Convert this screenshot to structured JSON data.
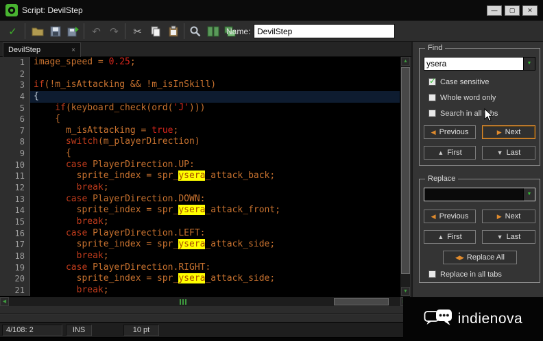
{
  "colors": {
    "accent_orange": "#e08b2d",
    "accent_green": "#3fae29",
    "match_highlight": "#ffff00",
    "editor_background": "#000000",
    "current_line_background": "#0e1c30"
  },
  "window": {
    "title": "Script: DevilStep",
    "minimize_glyph": "—",
    "maximize_glyph": "▢",
    "close_glyph": "✕"
  },
  "toolbar": {
    "accept_glyph": "✓",
    "undo_glyph": "↶",
    "redo_glyph": "↷",
    "cut_glyph": "✂",
    "name_label": "Name:",
    "name_value": "DevilStep"
  },
  "tab": {
    "label": "DevilStep",
    "close_glyph": "×"
  },
  "editor": {
    "current_line": 4,
    "lines": [
      {
        "n": 1,
        "t": [
          [
            "image_speed = ",
            "v"
          ],
          [
            "0.25",
            "l"
          ],
          [
            ";",
            "v"
          ]
        ]
      },
      {
        "n": 2,
        "t": []
      },
      {
        "n": 3,
        "t": [
          [
            "if",
            "k"
          ],
          [
            "(!m_isAttacking && !m_isInSkill)",
            "v"
          ]
        ]
      },
      {
        "n": 4,
        "t": [
          [
            "{",
            "c"
          ]
        ]
      },
      {
        "n": 5,
        "t": [
          [
            "    ",
            "v"
          ],
          [
            "if",
            "k"
          ],
          [
            "(keyboard_check(ord(",
            "v"
          ],
          [
            "'J'",
            "l"
          ],
          [
            ")))",
            "v"
          ]
        ]
      },
      {
        "n": 6,
        "t": [
          [
            "    {",
            "v"
          ]
        ]
      },
      {
        "n": 7,
        "t": [
          [
            "      m_isAttacking = ",
            "v"
          ],
          [
            "true",
            "l"
          ],
          [
            ";",
            "v"
          ]
        ]
      },
      {
        "n": 8,
        "t": [
          [
            "      ",
            "v"
          ],
          [
            "switch",
            "k"
          ],
          [
            "(m_playerDirection)",
            "v"
          ]
        ]
      },
      {
        "n": 9,
        "t": [
          [
            "      {",
            "v"
          ]
        ]
      },
      {
        "n": 10,
        "t": [
          [
            "      ",
            "v"
          ],
          [
            "case",
            "k"
          ],
          [
            " PlayerDirection.UP:",
            "v"
          ]
        ]
      },
      {
        "n": 11,
        "t": [
          [
            "        sprite_index = spr_",
            "v"
          ],
          [
            "ysera",
            "m"
          ],
          [
            "_attack_back;",
            "v"
          ]
        ]
      },
      {
        "n": 12,
        "t": [
          [
            "        ",
            "v"
          ],
          [
            "break",
            "k"
          ],
          [
            ";",
            "v"
          ]
        ]
      },
      {
        "n": 13,
        "t": [
          [
            "      ",
            "v"
          ],
          [
            "case",
            "k"
          ],
          [
            " PlayerDirection.DOWN:",
            "v"
          ]
        ]
      },
      {
        "n": 14,
        "t": [
          [
            "        sprite_index = spr_",
            "v"
          ],
          [
            "ysera",
            "m"
          ],
          [
            "_attack_front;",
            "v"
          ]
        ]
      },
      {
        "n": 15,
        "t": [
          [
            "        ",
            "v"
          ],
          [
            "break",
            "k"
          ],
          [
            ";",
            "v"
          ]
        ]
      },
      {
        "n": 16,
        "t": [
          [
            "      ",
            "v"
          ],
          [
            "case",
            "k"
          ],
          [
            " PlayerDirection.LEFT:",
            "v"
          ]
        ]
      },
      {
        "n": 17,
        "t": [
          [
            "        sprite_index = spr_",
            "v"
          ],
          [
            "ysera",
            "m"
          ],
          [
            "_attack_side;",
            "v"
          ]
        ]
      },
      {
        "n": 18,
        "t": [
          [
            "        ",
            "v"
          ],
          [
            "break",
            "k"
          ],
          [
            ";",
            "v"
          ]
        ]
      },
      {
        "n": 19,
        "t": [
          [
            "      ",
            "v"
          ],
          [
            "case",
            "k"
          ],
          [
            " PlayerDirection.RIGHT:",
            "v"
          ]
        ]
      },
      {
        "n": 20,
        "t": [
          [
            "        sprite_index = spr_",
            "v"
          ],
          [
            "ysera",
            "m"
          ],
          [
            "_attack_side;",
            "v"
          ]
        ]
      },
      {
        "n": 21,
        "t": [
          [
            "        ",
            "v"
          ],
          [
            "break",
            "k"
          ],
          [
            ";",
            "v"
          ]
        ]
      }
    ]
  },
  "scrollbars": {
    "up": "▲",
    "down": "▼",
    "left": "◀",
    "right": "▶"
  },
  "find_panel": {
    "title": "Find",
    "query": "ysera",
    "dropdown_glyph": "▼",
    "checkboxes": [
      {
        "label": "Case sensitive",
        "mark": "✓",
        "checked": true
      },
      {
        "label": "Whole word only",
        "mark": "",
        "checked": false
      },
      {
        "label": "Search in all tabs",
        "mark": "",
        "checked": false
      }
    ],
    "buttons": {
      "previous": {
        "label": "Previous",
        "glyph": "◀"
      },
      "next": {
        "label": "Next",
        "glyph": "▶"
      },
      "first": {
        "label": "First",
        "glyph": "▲"
      },
      "last": {
        "label": "Last",
        "glyph": "▼"
      }
    }
  },
  "replace_panel": {
    "title": "Replace",
    "query": "",
    "dropdown_glyph": "▼",
    "buttons": {
      "previous": {
        "label": "Previous",
        "glyph": "◀"
      },
      "next": {
        "label": "Next",
        "glyph": "▶"
      },
      "first": {
        "label": "First",
        "glyph": "▲"
      },
      "last": {
        "label": "Last",
        "glyph": "▼"
      },
      "replace_all": {
        "label": "Replace All",
        "glyph": "◀▶"
      }
    },
    "checkbox": {
      "label": "Replace in all tabs",
      "mark": "",
      "checked": false
    }
  },
  "status_bar": {
    "position": "4/108: 2",
    "mode": "INS",
    "font_size": "10 pt"
  },
  "branding": {
    "text": "indienova"
  }
}
